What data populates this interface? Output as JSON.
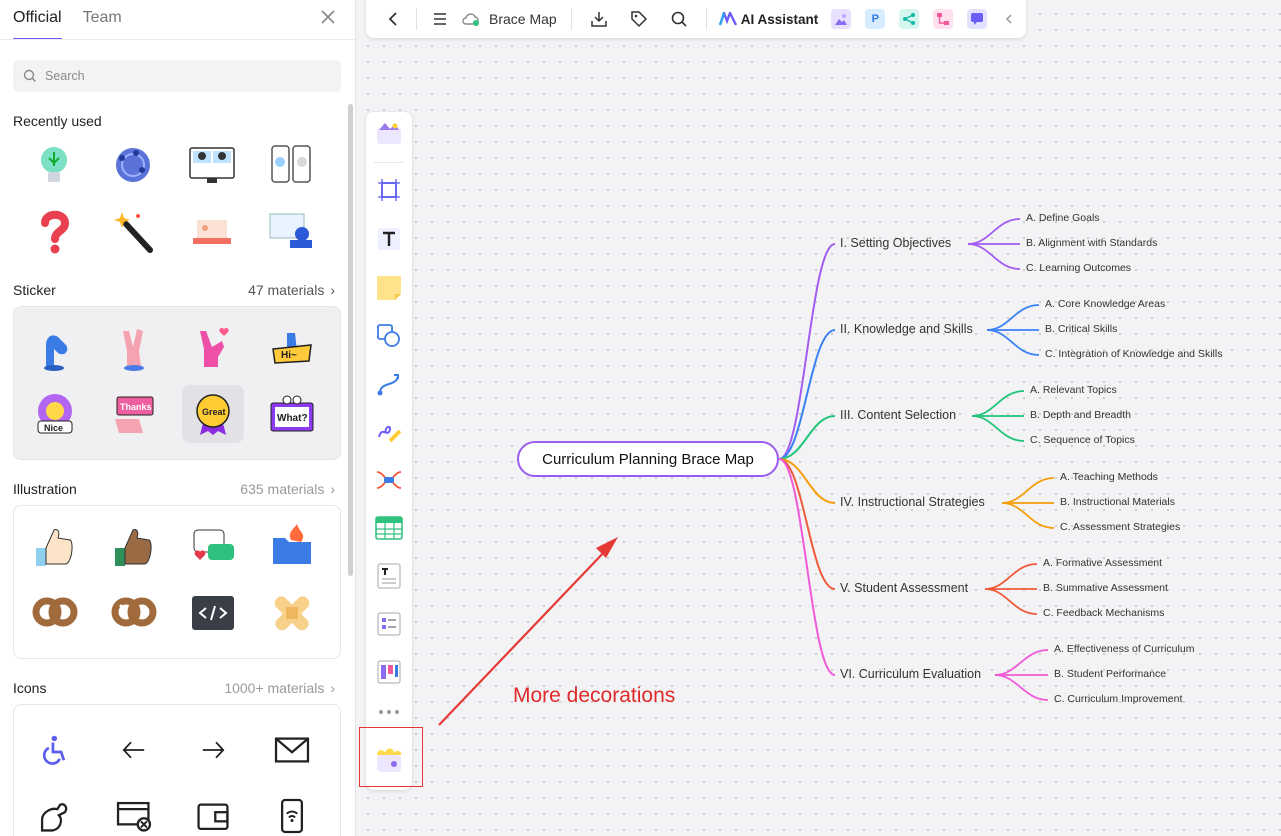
{
  "left_panel": {
    "tabs": [
      "Official",
      "Team"
    ],
    "search_placeholder": "Search",
    "recently_used": {
      "title": "Recently used",
      "items": [
        "lightbulb-sticker",
        "network-globe",
        "video-call-illustration",
        "mobile-chat-illustration",
        "question-mark",
        "magic-wand",
        "laptop-illustration",
        "presentation-illustration"
      ]
    },
    "sticker": {
      "title": "Sticker",
      "count": "47 materials",
      "items": [
        "ok-hand",
        "peace-hand",
        "love-hand",
        "hi-hand",
        "nice-flower",
        "thanks-hand",
        "great-badge",
        "what-sign"
      ]
    },
    "illustration": {
      "title": "Illustration",
      "count": "635 materials",
      "items": [
        "thumbs-up-light",
        "thumbs-up-dark",
        "chat-bubbles",
        "folder-fire",
        "pretzel",
        "pretzel-sugar",
        "code-window",
        "bandage"
      ]
    },
    "icons": {
      "title": "Icons",
      "count": "1000+ materials",
      "items": [
        "accessibility-icon",
        "arrow-left-icon",
        "arrow-right-icon",
        "envelope-icon",
        "strong-arm-icon",
        "card-remove-icon",
        "wallet-icon",
        "phone-wifi-icon"
      ]
    }
  },
  "toolbar": {
    "doc_title": "Brace Map",
    "ai_label": "AI Assistant"
  },
  "mindmap": {
    "root": "Curriculum Planning Brace Map",
    "branches": [
      {
        "label": "I. Setting Objectives",
        "color": "#a25cf0",
        "children": [
          "A. Define Goals",
          "B. Alignment with Standards",
          "C. Learning Outcomes"
        ]
      },
      {
        "label": "II. Knowledge and Skills",
        "color": "#3b82f6",
        "children": [
          "A. Core Knowledge Areas",
          "B. Critical Skills",
          "C. Integration of Knowledge and Skills"
        ]
      },
      {
        "label": "III. Content Selection",
        "color": "#22c47a",
        "children": [
          "A. Relevant Topics",
          "B. Depth and Breadth",
          "C. Sequence of Topics"
        ]
      },
      {
        "label": "IV. Instructional Strategies",
        "color": "#f59e0b",
        "children": [
          "A. Teaching Methods",
          "B. Instructional Materials",
          "C. Assessment Strategies"
        ]
      },
      {
        "label": "V. Student Assessment",
        "color": "#f05a3a",
        "children": [
          "A. Formative Assessment",
          "B. Summative Assessment",
          "C. Feedback Mechanisms"
        ]
      },
      {
        "label": "VI. Curriculum Evaluation",
        "color": "#f05ad8",
        "children": [
          "A. Effectiveness of Curriculum",
          "B. Student Performance",
          "C. Curriculum Improvement"
        ]
      }
    ]
  },
  "annotation": "More decorations",
  "colors": {
    "accent": "#6b5cf6",
    "root_border": "#9b5cf0",
    "annotation_red": "#e02a2a"
  }
}
